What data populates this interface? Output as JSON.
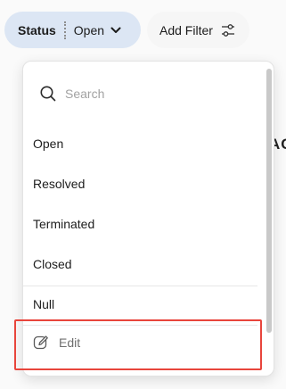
{
  "filter_bar": {
    "status_chip": {
      "key_label": "Status",
      "value_label": "Open",
      "chevron_icon": "chevron-down-icon"
    },
    "add_filter": {
      "label": "Add Filter",
      "icon": "sliders-icon"
    }
  },
  "background": {
    "clipped_text": "AC"
  },
  "dropdown": {
    "search": {
      "placeholder": "Search",
      "icon": "search-icon"
    },
    "options": [
      {
        "label": "Open"
      },
      {
        "label": "Resolved"
      },
      {
        "label": "Terminated"
      },
      {
        "label": "Closed"
      },
      {
        "label": "Null"
      }
    ],
    "edit": {
      "label": "Edit",
      "icon": "edit-icon"
    }
  },
  "colors": {
    "chip_bg": "#dce6f4",
    "highlight": "#e8453c"
  }
}
